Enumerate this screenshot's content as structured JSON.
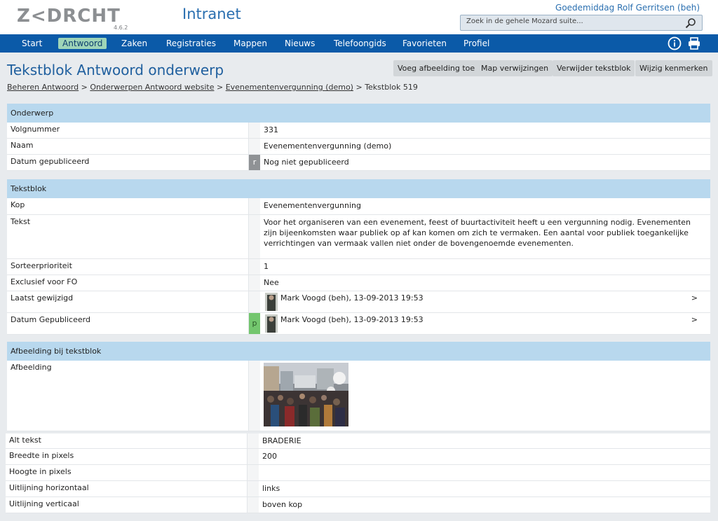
{
  "header": {
    "logo": "Z<DRCHT",
    "version": "4.6.2",
    "app_title": "Intranet",
    "greeting": "Goedemiddag Rolf Gerritsen (beh)",
    "search_placeholder": "Zoek in de gehele Mozard suite..."
  },
  "nav": {
    "items": [
      "Start",
      "Antwoord",
      "Zaken",
      "Registraties",
      "Mappen",
      "Nieuws",
      "Telefoongids",
      "Favorieten",
      "Profiel"
    ],
    "active": "Antwoord"
  },
  "page": {
    "title": "Tekstblok Antwoord onderwerp",
    "actions": [
      "Voeg afbeelding toe",
      "Map verwijzingen",
      "Verwijder tekstblok",
      "Wijzig kenmerken"
    ],
    "breadcrumb": [
      "Beheren Antwoord",
      "Onderwerpen Antwoord website",
      "Evenementenvergunning (demo)",
      "Tekstblok 519"
    ]
  },
  "onderwerp": {
    "heading": "Onderwerp",
    "rows": [
      {
        "label": "Volgnummer",
        "value": "331"
      },
      {
        "label": "Naam",
        "value": "Evenementenvergunning (demo)"
      },
      {
        "label": "Datum gepubliceerd",
        "flag": "r",
        "value": "Nog niet gepubliceerd"
      }
    ]
  },
  "tekstblok": {
    "heading": "Tekstblok",
    "kop_label": "Kop",
    "kop_value": "Evenementenvergunning",
    "tekst_label": "Tekst",
    "tekst_value": "Voor het organiseren van een evenement, feest of buurtactiviteit heeft u een vergunning nodig. Evenementen zijn bijeenkomsten waar publiek op af kan komen om zich te vermaken. Een aantal voor publiek toegankelijke verrichtingen van vermaak vallen niet onder de bovengenoemde evenementen.",
    "sort_label": "Sorteerprioriteit",
    "sort_value": "1",
    "excl_label": "Exclusief voor FO",
    "excl_value": "Nee",
    "changed_label": "Laatst gewijzigd",
    "changed_value": "Mark Voogd (beh), 13-09-2013 19:53",
    "pub_label": "Datum Gepubliceerd",
    "pub_flag": "p",
    "pub_value": "Mark Voogd (beh), 13-09-2013 19:53",
    "arrow": ">"
  },
  "afbeelding": {
    "heading": "Afbeelding bij tekstblok",
    "image_label": "Afbeelding",
    "rows": [
      {
        "label": "Alt tekst",
        "value": "BRADERIE"
      },
      {
        "label": "Breedte in pixels",
        "value": "200"
      },
      {
        "label": "Hoogte in pixels",
        "value": ""
      },
      {
        "label": "Uitlijning horizontaal",
        "value": "links"
      },
      {
        "label": "Uitlijning verticaal",
        "value": "boven kop"
      }
    ]
  },
  "colors": {
    "nav_bg": "#0b5aa8",
    "nav_active": "#9fd5b8",
    "panel_head": "#b8d8ee",
    "title_blue": "#1f5f9e",
    "flag_r": "#8f9295",
    "flag_p": "#73c66e"
  },
  "icons": [
    "search-icon",
    "info-icon",
    "print-icon"
  ]
}
